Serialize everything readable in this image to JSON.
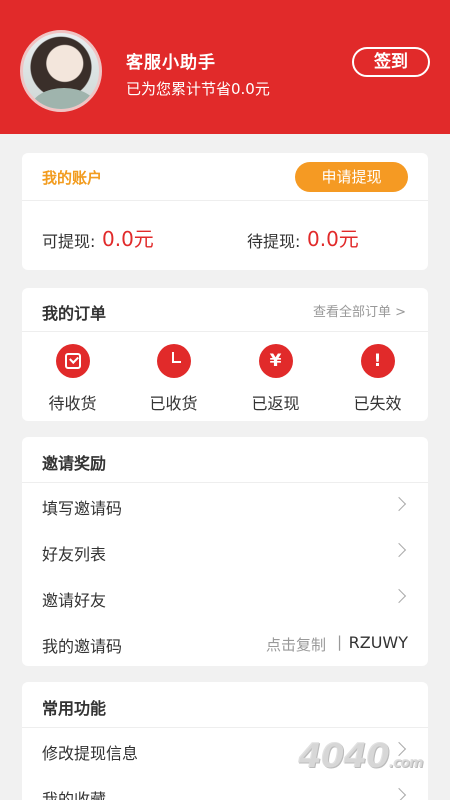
{
  "header": {
    "user_name": "客服小助手",
    "saved_text": "已为您累计节省0.0元",
    "signin_label": "签到"
  },
  "account": {
    "title": "我的账户",
    "withdraw_label": "申请提现",
    "available_label": "可提现:",
    "available_value": "0.0元",
    "pending_label": "待提现:",
    "pending_value": "0.0元"
  },
  "orders": {
    "title": "我的订单",
    "view_all": "查看全部订单 >",
    "items": [
      {
        "label": "待收货",
        "icon": "check-box-icon"
      },
      {
        "label": "已收货",
        "icon": "clock-icon"
      },
      {
        "label": "已返现",
        "icon": "yen-icon",
        "glyph": "¥"
      },
      {
        "label": "已失效",
        "icon": "exclamation-icon",
        "glyph": "!"
      }
    ]
  },
  "invite": {
    "title": "邀请奖励",
    "rows": [
      {
        "label": "填写邀请码"
      },
      {
        "label": "好友列表"
      },
      {
        "label": "邀请好友"
      }
    ],
    "my_code_label": "我的邀请码",
    "copy_hint": "点击复制",
    "separator": "|",
    "code": "RZUWY"
  },
  "common": {
    "title": "常用功能",
    "rows": [
      {
        "label": "修改提现信息"
      },
      {
        "label": "我的收藏"
      }
    ]
  },
  "watermark": {
    "text": "4040",
    "suffix": ".com"
  },
  "colors": {
    "brand_red": "#e12a2a",
    "accent_orange": "#f59a23",
    "background": "#f1f1f1"
  }
}
